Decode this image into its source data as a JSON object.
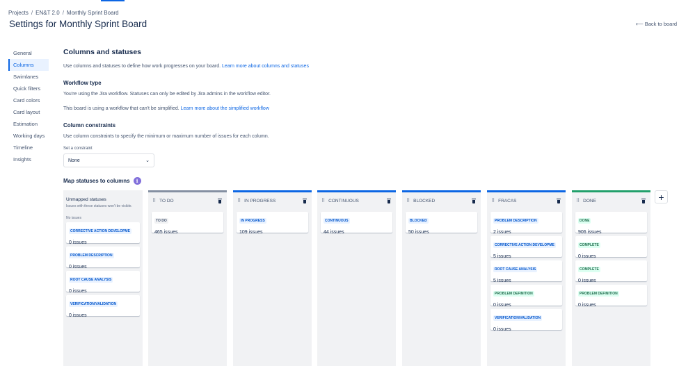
{
  "breadcrumb": [
    "Projects",
    "EN&T 2.0",
    "Monthly Sprint Board"
  ],
  "page_title": "Settings for Monthly Sprint Board",
  "back_link": "Back to board",
  "sidebar": {
    "items": [
      {
        "label": "General",
        "active": false
      },
      {
        "label": "Columns",
        "active": true
      },
      {
        "label": "Swimlanes",
        "active": false
      },
      {
        "label": "Quick filters",
        "active": false
      },
      {
        "label": "Card colors",
        "active": false
      },
      {
        "label": "Card layout",
        "active": false
      },
      {
        "label": "Estimation",
        "active": false
      },
      {
        "label": "Working days",
        "active": false
      },
      {
        "label": "Timeline",
        "active": false
      },
      {
        "label": "Insights",
        "active": false
      }
    ]
  },
  "section": {
    "title": "Columns and statuses",
    "intro": "Use columns and statuses to define how work progresses on your board.",
    "intro_link": "Learn more about columns and statuses",
    "workflow_title": "Workflow type",
    "workflow_text": "You're using the Jira workflow. Statuses can only be edited by Jira admins in the workflow editor.",
    "workflow_note": "This board is using a workflow that can't be simplified.",
    "workflow_link": "Learn more about the simplified workflow",
    "constraints_title": "Column constraints",
    "constraints_text": "Use column constraints to specify the minimum or maximum number of issues for each column.",
    "constraint_label": "Set a constraint",
    "constraint_value": "None",
    "map_title": "Map statuses to columns"
  },
  "unmapped": {
    "title": "Unmapped statuses",
    "description": "Issues with these statuses won't be visible.",
    "no_issues": "No issues",
    "cards": [
      {
        "status": "CORRECTIVE ACTION DEVELOPME",
        "count": "0 issues",
        "color": "blue"
      },
      {
        "status": "PROBLEM DESCRIPTION",
        "count": "0 issues",
        "color": "blue"
      },
      {
        "status": "ROOT CAUSE ANALYSIS",
        "count": "0 issues",
        "color": "blue"
      },
      {
        "status": "VERIFICATION/VALIDATION",
        "count": "0 issues",
        "color": "blue"
      }
    ]
  },
  "columns": [
    {
      "name": "TO DO",
      "top_color": "grey",
      "cards": [
        {
          "status": "TO DO",
          "count": "465 issues",
          "color": "grey"
        }
      ]
    },
    {
      "name": "IN PROGRESS",
      "top_color": "blue",
      "cards": [
        {
          "status": "IN PROGRESS",
          "count": "109 issues",
          "color": "blue"
        }
      ]
    },
    {
      "name": "CONTINUOUS",
      "top_color": "blue",
      "cards": [
        {
          "status": "CONTINUOUS",
          "count": "44 issues",
          "color": "blue"
        }
      ]
    },
    {
      "name": "BLOCKED",
      "top_color": "blue",
      "cards": [
        {
          "status": "BLOCKED",
          "count": "50 issues",
          "color": "blue"
        }
      ]
    },
    {
      "name": "FRACAS",
      "top_color": "blue",
      "cards": [
        {
          "status": "PROBLEM DESCRIPTION",
          "count": "2 issues",
          "color": "blue"
        },
        {
          "status": "CORRECTIVE ACTION DEVELOPME",
          "count": "5 issues",
          "color": "blue"
        },
        {
          "status": "ROOT CAUSE ANALYSIS",
          "count": "5 issues",
          "color": "blue"
        },
        {
          "status": "PROBLEM DEFINITION",
          "count": "0 issues",
          "color": "green"
        },
        {
          "status": "VERIFICATION/VALIDATION",
          "count": "0 issues",
          "color": "blue"
        }
      ]
    },
    {
      "name": "DONE",
      "top_color": "green",
      "cards": [
        {
          "status": "DONE",
          "count": "906 issues",
          "color": "green"
        },
        {
          "status": "COMPLETE",
          "count": "0 issues",
          "color": "green"
        },
        {
          "status": "COMPLETE",
          "count": "0 issues",
          "color": "green"
        },
        {
          "status": "PROBLEM DEFINITION",
          "count": "0 issues",
          "color": "green"
        }
      ]
    }
  ],
  "colors": {
    "accent": "#0c66e4",
    "grey_top": "#8590a2",
    "green_top": "#22a06b",
    "column_bg": "#f1f2f4"
  }
}
